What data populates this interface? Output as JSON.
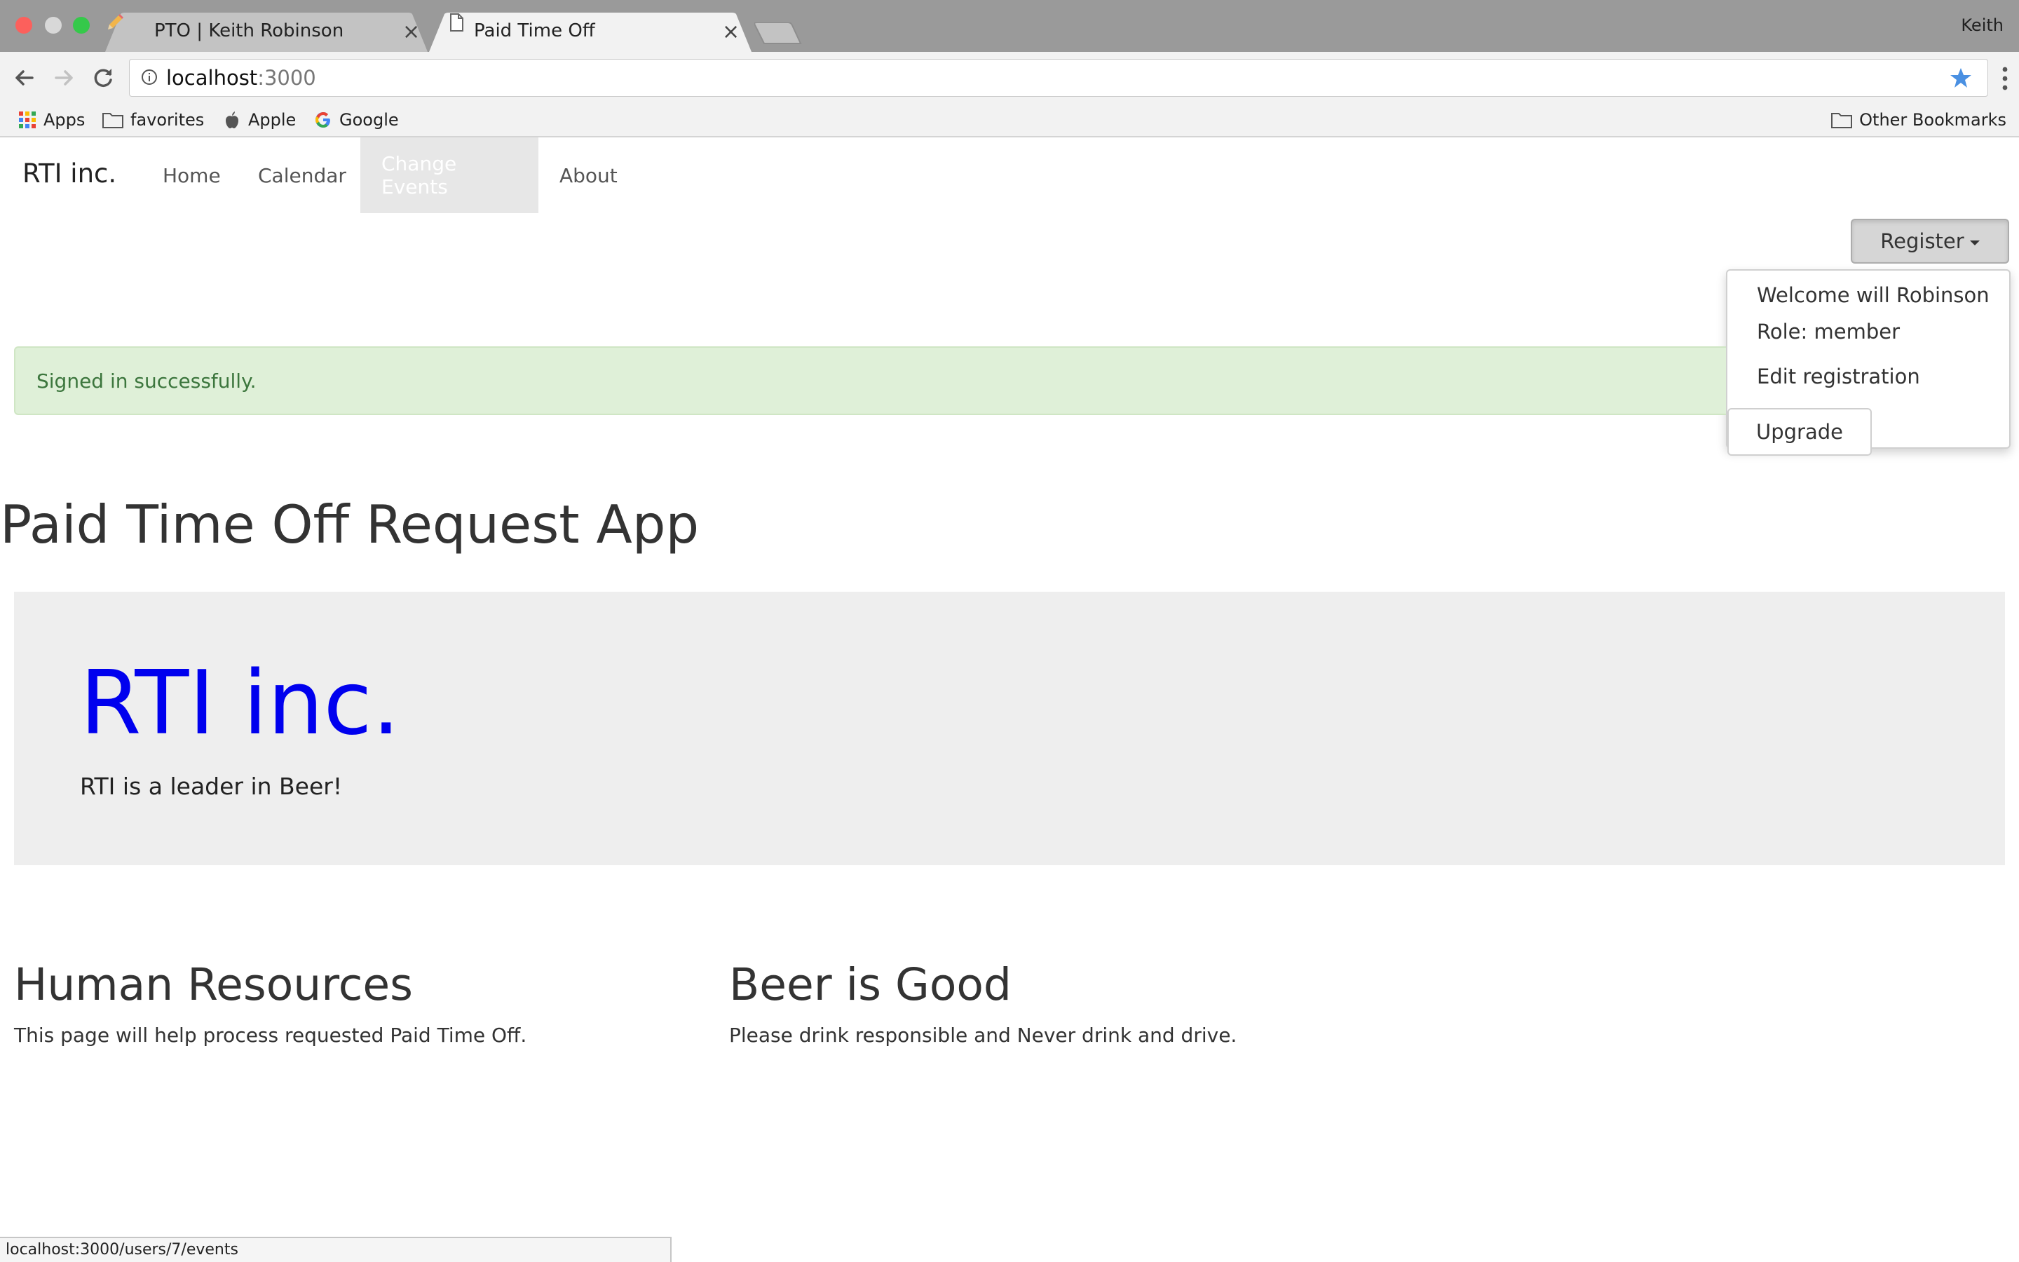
{
  "browser": {
    "tabs": [
      {
        "title": "PTO | Keith Robinson",
        "icon": "pencil-icon",
        "active": false
      },
      {
        "title": "Paid Time Off",
        "icon": "page-icon",
        "active": true
      }
    ],
    "profile_name": "Keith",
    "url_host": "localhost",
    "url_port": ":3000",
    "bookmarks": [
      {
        "label": "Apps",
        "icon": "apps-grid-icon"
      },
      {
        "label": "favorites",
        "icon": "folder-icon"
      },
      {
        "label": "Apple",
        "icon": "apple-icon"
      },
      {
        "label": "Google",
        "icon": "google-icon"
      }
    ],
    "other_bookmarks": "Other Bookmarks",
    "status_url": "localhost:3000/users/7/events"
  },
  "navbar": {
    "brand": "RTI inc.",
    "links": [
      {
        "label": "Home"
      },
      {
        "label": "Calendar"
      },
      {
        "label": "Change Events",
        "active": true
      },
      {
        "label": "About"
      }
    ]
  },
  "account": {
    "register_label": "Register",
    "dropdown": {
      "welcome": "Welcome will Robinson",
      "role": "Role: member",
      "edit": "Edit registration",
      "upgrade": "Upgrade"
    }
  },
  "flash": {
    "message": "Signed in successfully."
  },
  "main": {
    "title": "Paid Time Off Request App",
    "jumbotron": {
      "heading": "RTI inc.",
      "tagline": "RTI is a leader in Beer!"
    },
    "columns": [
      {
        "heading": "Human Resources",
        "text": "This page will help process requested Paid Time Off."
      },
      {
        "heading": "Beer is Good",
        "text": "Please drink responsible and Never drink and drive."
      }
    ]
  },
  "colors": {
    "jumbo_heading": "#0000ee",
    "alert_bg": "#dff0d8",
    "alert_text": "#3c763d",
    "bookmark_star": "#4a90e2"
  }
}
